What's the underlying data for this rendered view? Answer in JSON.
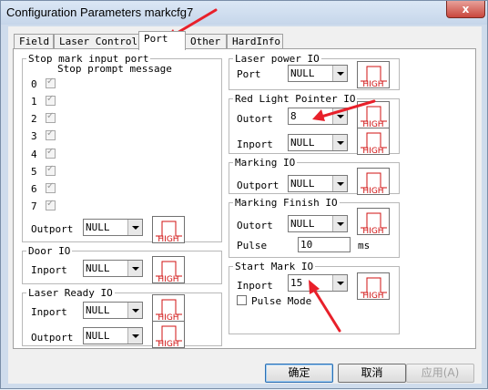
{
  "window": {
    "title": "Configuration Parameters markcfg7",
    "close": "x"
  },
  "tabs": [
    "Field",
    "Laser Control",
    "Port",
    "Other",
    "HardInfo"
  ],
  "active_tab": "Port",
  "stop_mark": {
    "legend": "Stop mark input port",
    "prompt": "Stop prompt message",
    "ports": [
      "0",
      "1",
      "2",
      "3",
      "4",
      "5",
      "6",
      "7"
    ],
    "outport_label": "Outport",
    "outport_value": "NULL"
  },
  "door_io": {
    "legend": "Door IO",
    "inport_label": "Inport",
    "inport_value": "NULL"
  },
  "laser_ready_io": {
    "legend": "Laser Ready IO",
    "inport_label": "Inport",
    "inport_value": "NULL",
    "outport_label": "Outport",
    "outport_value": "NULL"
  },
  "laser_power_io": {
    "legend": "Laser power IO",
    "port_label": "Port",
    "port_value": "NULL"
  },
  "red_light_io": {
    "legend": "Red Light Pointer IO",
    "outport_label": "Outort",
    "outport_value": "8",
    "inport_label": "Inport",
    "inport_value": "NULL"
  },
  "marking_io": {
    "legend": "Marking IO",
    "outport_label": "Outport",
    "outport_value": "NULL"
  },
  "marking_finish_io": {
    "legend": "Marking Finish IO",
    "outport_label": "Outort",
    "outport_value": "NULL",
    "pulse_label": "Pulse",
    "pulse_value": "10",
    "pulse_unit": "ms"
  },
  "start_mark_io": {
    "legend": "Start Mark IO",
    "inport_label": "Inport",
    "inport_value": "15",
    "pulse_mode_label": "Pulse Mode"
  },
  "high_label": "HIGH",
  "buttons": {
    "ok": "确定",
    "cancel": "取消",
    "apply": "应用(A)"
  },
  "colors": {
    "annotation_arrow": "#e8202a",
    "high_signal": "#d01010"
  }
}
